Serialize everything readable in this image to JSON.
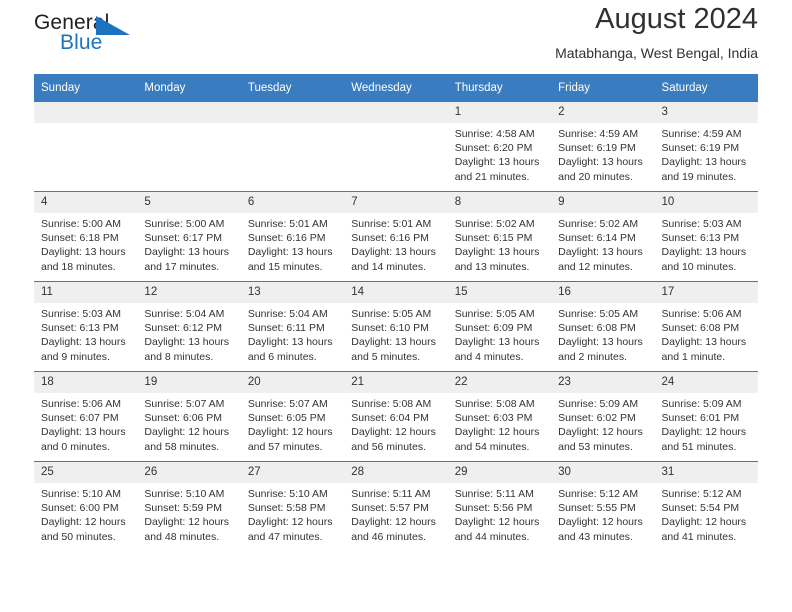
{
  "logo": {
    "word1": "General",
    "word2": "Blue",
    "triangle_color": "#1e73be"
  },
  "header": {
    "title": "August 2024",
    "subtitle": "Matabhanga, West Bengal, India"
  },
  "colors": {
    "header_band": "#3a7cc0",
    "day_band": "#efefef",
    "text": "#333333"
  },
  "weekdays": [
    "Sunday",
    "Monday",
    "Tuesday",
    "Wednesday",
    "Thursday",
    "Friday",
    "Saturday"
  ],
  "weeks": [
    [
      {
        "day": "",
        "sunrise": "",
        "sunset": "",
        "daylight": "",
        "empty": true
      },
      {
        "day": "",
        "sunrise": "",
        "sunset": "",
        "daylight": "",
        "empty": true
      },
      {
        "day": "",
        "sunrise": "",
        "sunset": "",
        "daylight": "",
        "empty": true
      },
      {
        "day": "",
        "sunrise": "",
        "sunset": "",
        "daylight": "",
        "empty": true
      },
      {
        "day": "1",
        "sunrise": "Sunrise: 4:58 AM",
        "sunset": "Sunset: 6:20 PM",
        "daylight": "Daylight: 13 hours and 21 minutes."
      },
      {
        "day": "2",
        "sunrise": "Sunrise: 4:59 AM",
        "sunset": "Sunset: 6:19 PM",
        "daylight": "Daylight: 13 hours and 20 minutes."
      },
      {
        "day": "3",
        "sunrise": "Sunrise: 4:59 AM",
        "sunset": "Sunset: 6:19 PM",
        "daylight": "Daylight: 13 hours and 19 minutes."
      }
    ],
    [
      {
        "day": "4",
        "sunrise": "Sunrise: 5:00 AM",
        "sunset": "Sunset: 6:18 PM",
        "daylight": "Daylight: 13 hours and 18 minutes."
      },
      {
        "day": "5",
        "sunrise": "Sunrise: 5:00 AM",
        "sunset": "Sunset: 6:17 PM",
        "daylight": "Daylight: 13 hours and 17 minutes."
      },
      {
        "day": "6",
        "sunrise": "Sunrise: 5:01 AM",
        "sunset": "Sunset: 6:16 PM",
        "daylight": "Daylight: 13 hours and 15 minutes."
      },
      {
        "day": "7",
        "sunrise": "Sunrise: 5:01 AM",
        "sunset": "Sunset: 6:16 PM",
        "daylight": "Daylight: 13 hours and 14 minutes."
      },
      {
        "day": "8",
        "sunrise": "Sunrise: 5:02 AM",
        "sunset": "Sunset: 6:15 PM",
        "daylight": "Daylight: 13 hours and 13 minutes."
      },
      {
        "day": "9",
        "sunrise": "Sunrise: 5:02 AM",
        "sunset": "Sunset: 6:14 PM",
        "daylight": "Daylight: 13 hours and 12 minutes."
      },
      {
        "day": "10",
        "sunrise": "Sunrise: 5:03 AM",
        "sunset": "Sunset: 6:13 PM",
        "daylight": "Daylight: 13 hours and 10 minutes."
      }
    ],
    [
      {
        "day": "11",
        "sunrise": "Sunrise: 5:03 AM",
        "sunset": "Sunset: 6:13 PM",
        "daylight": "Daylight: 13 hours and 9 minutes."
      },
      {
        "day": "12",
        "sunrise": "Sunrise: 5:04 AM",
        "sunset": "Sunset: 6:12 PM",
        "daylight": "Daylight: 13 hours and 8 minutes."
      },
      {
        "day": "13",
        "sunrise": "Sunrise: 5:04 AM",
        "sunset": "Sunset: 6:11 PM",
        "daylight": "Daylight: 13 hours and 6 minutes."
      },
      {
        "day": "14",
        "sunrise": "Sunrise: 5:05 AM",
        "sunset": "Sunset: 6:10 PM",
        "daylight": "Daylight: 13 hours and 5 minutes."
      },
      {
        "day": "15",
        "sunrise": "Sunrise: 5:05 AM",
        "sunset": "Sunset: 6:09 PM",
        "daylight": "Daylight: 13 hours and 4 minutes."
      },
      {
        "day": "16",
        "sunrise": "Sunrise: 5:05 AM",
        "sunset": "Sunset: 6:08 PM",
        "daylight": "Daylight: 13 hours and 2 minutes."
      },
      {
        "day": "17",
        "sunrise": "Sunrise: 5:06 AM",
        "sunset": "Sunset: 6:08 PM",
        "daylight": "Daylight: 13 hours and 1 minute."
      }
    ],
    [
      {
        "day": "18",
        "sunrise": "Sunrise: 5:06 AM",
        "sunset": "Sunset: 6:07 PM",
        "daylight": "Daylight: 13 hours and 0 minutes."
      },
      {
        "day": "19",
        "sunrise": "Sunrise: 5:07 AM",
        "sunset": "Sunset: 6:06 PM",
        "daylight": "Daylight: 12 hours and 58 minutes."
      },
      {
        "day": "20",
        "sunrise": "Sunrise: 5:07 AM",
        "sunset": "Sunset: 6:05 PM",
        "daylight": "Daylight: 12 hours and 57 minutes."
      },
      {
        "day": "21",
        "sunrise": "Sunrise: 5:08 AM",
        "sunset": "Sunset: 6:04 PM",
        "daylight": "Daylight: 12 hours and 56 minutes."
      },
      {
        "day": "22",
        "sunrise": "Sunrise: 5:08 AM",
        "sunset": "Sunset: 6:03 PM",
        "daylight": "Daylight: 12 hours and 54 minutes."
      },
      {
        "day": "23",
        "sunrise": "Sunrise: 5:09 AM",
        "sunset": "Sunset: 6:02 PM",
        "daylight": "Daylight: 12 hours and 53 minutes."
      },
      {
        "day": "24",
        "sunrise": "Sunrise: 5:09 AM",
        "sunset": "Sunset: 6:01 PM",
        "daylight": "Daylight: 12 hours and 51 minutes."
      }
    ],
    [
      {
        "day": "25",
        "sunrise": "Sunrise: 5:10 AM",
        "sunset": "Sunset: 6:00 PM",
        "daylight": "Daylight: 12 hours and 50 minutes."
      },
      {
        "day": "26",
        "sunrise": "Sunrise: 5:10 AM",
        "sunset": "Sunset: 5:59 PM",
        "daylight": "Daylight: 12 hours and 48 minutes."
      },
      {
        "day": "27",
        "sunrise": "Sunrise: 5:10 AM",
        "sunset": "Sunset: 5:58 PM",
        "daylight": "Daylight: 12 hours and 47 minutes."
      },
      {
        "day": "28",
        "sunrise": "Sunrise: 5:11 AM",
        "sunset": "Sunset: 5:57 PM",
        "daylight": "Daylight: 12 hours and 46 minutes."
      },
      {
        "day": "29",
        "sunrise": "Sunrise: 5:11 AM",
        "sunset": "Sunset: 5:56 PM",
        "daylight": "Daylight: 12 hours and 44 minutes."
      },
      {
        "day": "30",
        "sunrise": "Sunrise: 5:12 AM",
        "sunset": "Sunset: 5:55 PM",
        "daylight": "Daylight: 12 hours and 43 minutes."
      },
      {
        "day": "31",
        "sunrise": "Sunrise: 5:12 AM",
        "sunset": "Sunset: 5:54 PM",
        "daylight": "Daylight: 12 hours and 41 minutes."
      }
    ]
  ]
}
